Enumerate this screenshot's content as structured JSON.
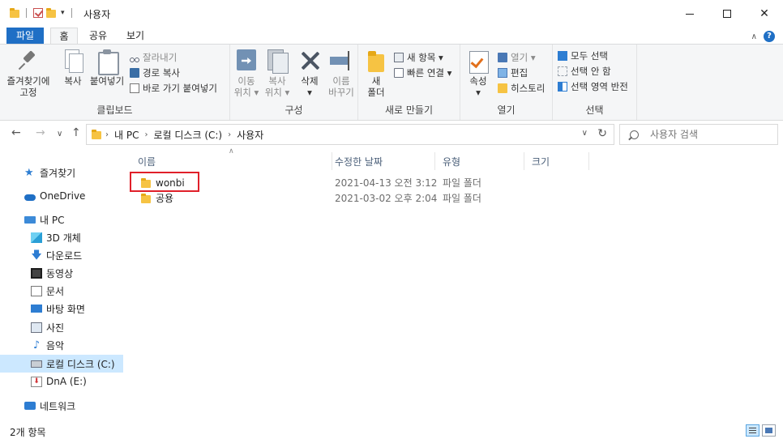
{
  "window": {
    "title": "사용자"
  },
  "ribbon_tabs": {
    "file": "파일",
    "home": "홈",
    "share": "공유",
    "view": "보기",
    "help": "?"
  },
  "ribbon": {
    "clipboard": {
      "label": "클립보드",
      "pin_quick_access_line1": "즐겨찾기에",
      "pin_quick_access_line2": "고정",
      "copy": "복사",
      "paste": "붙여넣기",
      "cut": "잘라내기",
      "copy_path": "경로 복사",
      "paste_shortcut": "바로 가기 붙여넣기"
    },
    "organize": {
      "label": "구성",
      "move_to_line1": "이동",
      "move_to_line2": "위치 ▾",
      "copy_to_line1": "복사",
      "copy_to_line2": "위치 ▾",
      "delete": "삭제",
      "delete_arrow": "▾",
      "rename_line1": "이름",
      "rename_line2": "바꾸기"
    },
    "new": {
      "label": "새로 만들기",
      "new_folder_line1": "새",
      "new_folder_line2": "폴더",
      "new_item": "새 항목 ▾",
      "easy_access": "빠른 연결 ▾"
    },
    "open": {
      "label": "열기",
      "properties": "속성",
      "properties_arrow": "▾",
      "open": "열기 ▾",
      "edit": "편집",
      "history": "히스토리"
    },
    "select": {
      "label": "선택",
      "select_all": "모두 선택",
      "select_none": "선택 안 함",
      "invert_selection": "선택 영역 반전"
    }
  },
  "address_bar": {
    "crumbs": [
      "내 PC",
      "로컬 디스크 (C:)",
      "사용자"
    ],
    "search_placeholder": "사용자 검색"
  },
  "nav_pane": {
    "quick_access": "즐겨찾기",
    "onedrive": "OneDrive",
    "this_pc": "내 PC",
    "items": [
      "3D 개체",
      "다운로드",
      "동영상",
      "문서",
      "바탕 화면",
      "사진",
      "음악",
      "로컬 디스크 (C:)",
      "DnA (E:)"
    ],
    "network": "네트워크"
  },
  "file_list": {
    "columns": [
      "이름",
      "수정한 날짜",
      "유형",
      "크기"
    ],
    "rows": [
      {
        "name": "wonbi",
        "date": "2021-04-13 오전 3:12",
        "type": "파일 폴더"
      },
      {
        "name": "공용",
        "date": "2021-03-02 오후 2:04",
        "type": "파일 폴더"
      }
    ]
  },
  "status_bar": {
    "item_count": "2개 항목"
  },
  "colors": {
    "accent": "#1f6fc5",
    "selection": "#cce8ff",
    "highlight_box": "#e0202a",
    "folder": "#f6c343"
  }
}
